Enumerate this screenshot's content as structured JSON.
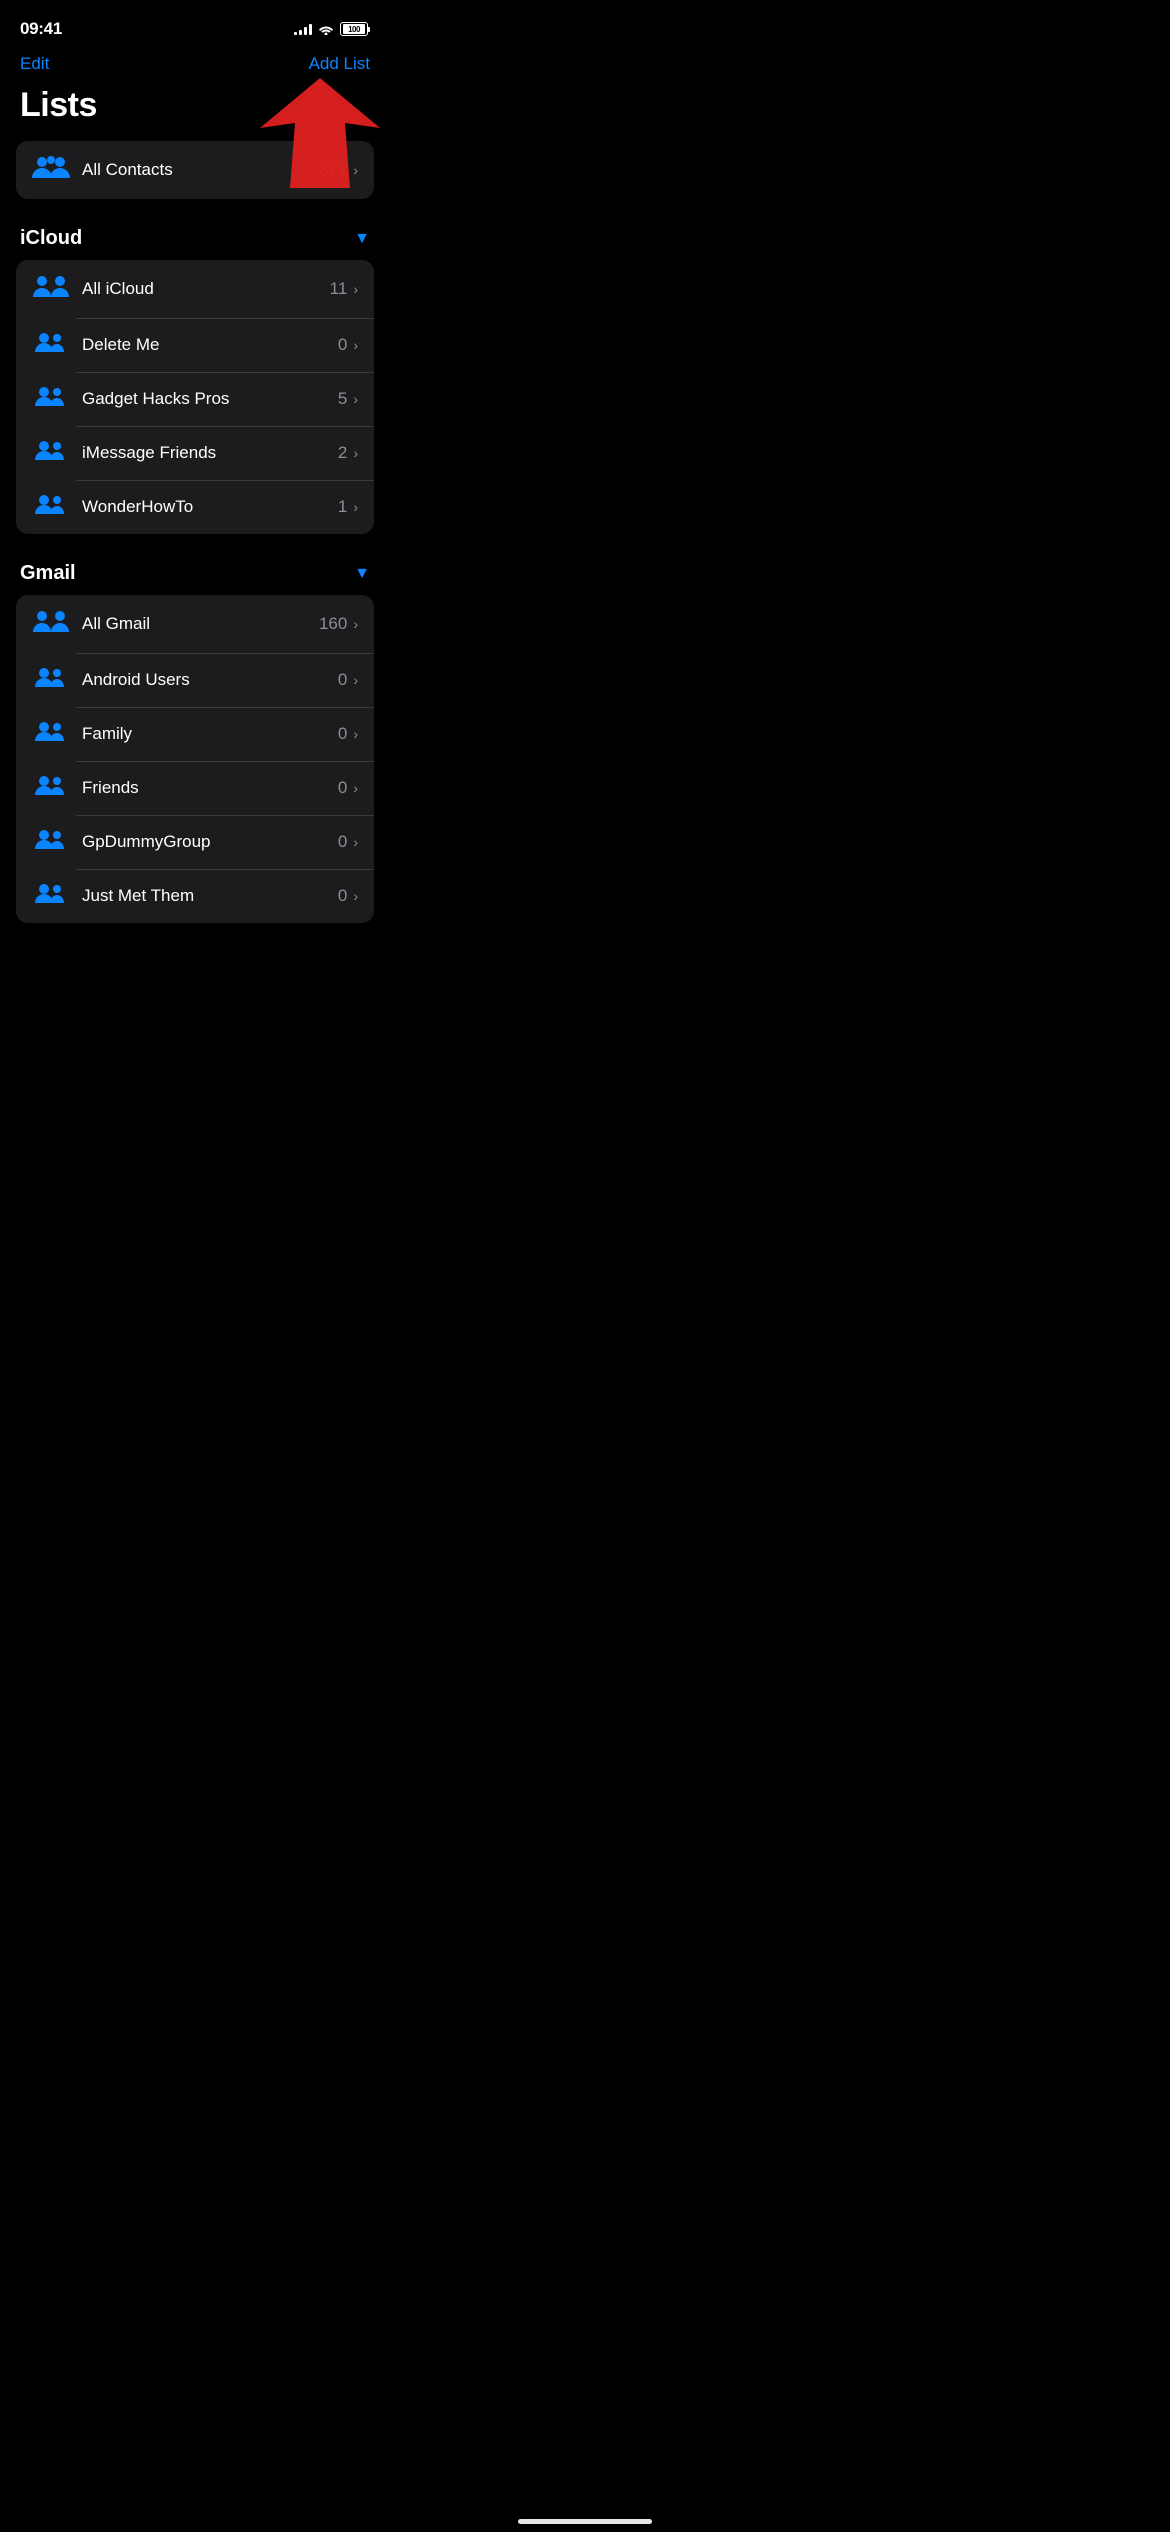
{
  "statusBar": {
    "time": "09:41",
    "battery": "100"
  },
  "nav": {
    "editLabel": "Edit",
    "addListLabel": "Add List"
  },
  "pageTitle": "Lists",
  "allContacts": {
    "name": "All Contacts",
    "count": "372"
  },
  "sections": [
    {
      "id": "icloud",
      "title": "iCloud",
      "items": [
        {
          "name": "All iCloud",
          "count": "11",
          "iconSize": "lg"
        },
        {
          "name": "Delete Me",
          "count": "0",
          "iconSize": "sm"
        },
        {
          "name": "Gadget Hacks Pros",
          "count": "5",
          "iconSize": "sm"
        },
        {
          "name": "iMessage Friends",
          "count": "2",
          "iconSize": "sm"
        },
        {
          "name": "WonderHowTo",
          "count": "1",
          "iconSize": "sm"
        }
      ]
    },
    {
      "id": "gmail",
      "title": "Gmail",
      "items": [
        {
          "name": "All Gmail",
          "count": "160",
          "iconSize": "lg"
        },
        {
          "name": "Android Users",
          "count": "0",
          "iconSize": "sm"
        },
        {
          "name": "Family",
          "count": "0",
          "iconSize": "sm"
        },
        {
          "name": "Friends",
          "count": "0",
          "iconSize": "sm"
        },
        {
          "name": "GpDummyGroup",
          "count": "0",
          "iconSize": "sm"
        },
        {
          "name": "Just Met Them",
          "count": "0",
          "iconSize": "sm"
        }
      ]
    }
  ],
  "icons": {
    "chevronDown": "▼",
    "chevronRight": "›",
    "accent": "#0a84ff"
  }
}
